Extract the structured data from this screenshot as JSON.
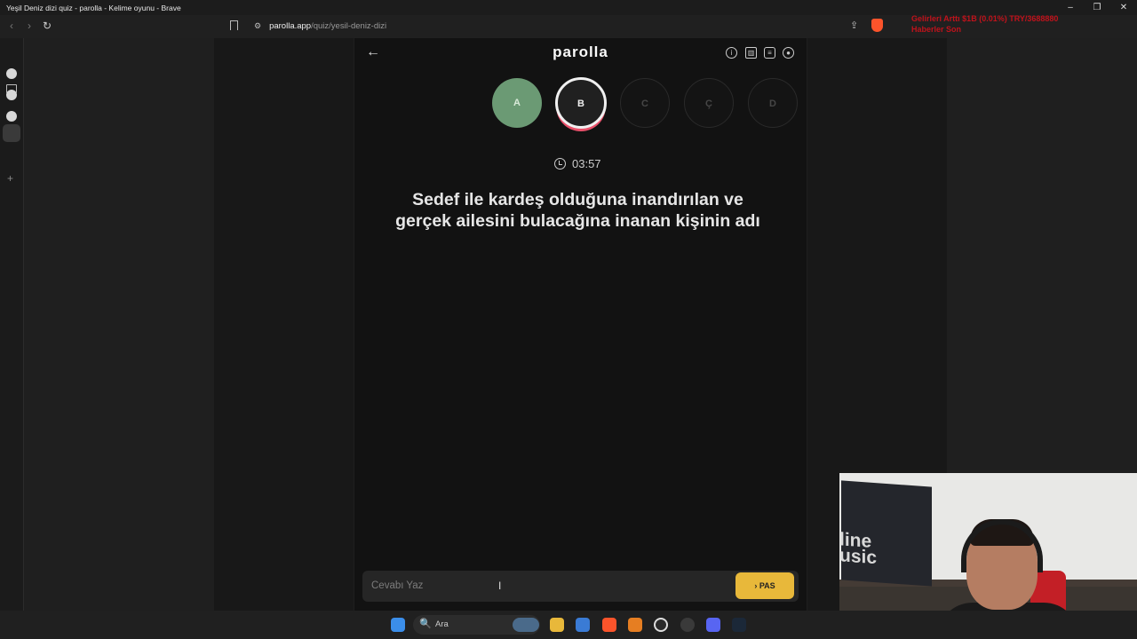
{
  "window": {
    "title": "Yeşil Deniz dizi quiz - parolla - Kelime oyunu - Brave",
    "controls": {
      "minimize": "–",
      "maximize": "❐",
      "close": "✕"
    }
  },
  "browser": {
    "url_host": "parolla.app",
    "url_path": "/quiz/yesil-deniz-dizi",
    "nav": {
      "back": "‹",
      "forward": "›",
      "reload": "↻"
    },
    "share_icon": "⇪"
  },
  "stream_overlay": {
    "line1": "Gelirleri Arttı    $1B (0.01%)      TRY/3688880",
    "line2": "Haberler Son"
  },
  "sidebar": {
    "plus": "+"
  },
  "app": {
    "logo": "parolla",
    "back_icon": "←",
    "header_icons": [
      "info-icon",
      "stats-icon",
      "chat-icon",
      "account-icon"
    ],
    "letters": [
      {
        "label": "A",
        "state": "correct"
      },
      {
        "label": "B",
        "state": "active"
      },
      {
        "label": "C",
        "state": "pending"
      },
      {
        "label": "Ç",
        "state": "pending"
      },
      {
        "label": "D",
        "state": "pending"
      }
    ],
    "timer": "03:57",
    "question": "Sedef ile kardeş olduğuna inandırılan ve gerçek ailesini bulacağına inanan kişinin adı",
    "answer_placeholder": "Cevabı Yaz",
    "pass_button": "› PAS"
  },
  "webcam": {
    "monitor_text": "line\nusic"
  },
  "taskbar": {
    "search_label": "Ara",
    "search_icon": "🔍"
  },
  "colors": {
    "correct": "#6b9a74",
    "pass": "#e8b83a",
    "active_ring": "#e9506a",
    "background": "#121212"
  }
}
